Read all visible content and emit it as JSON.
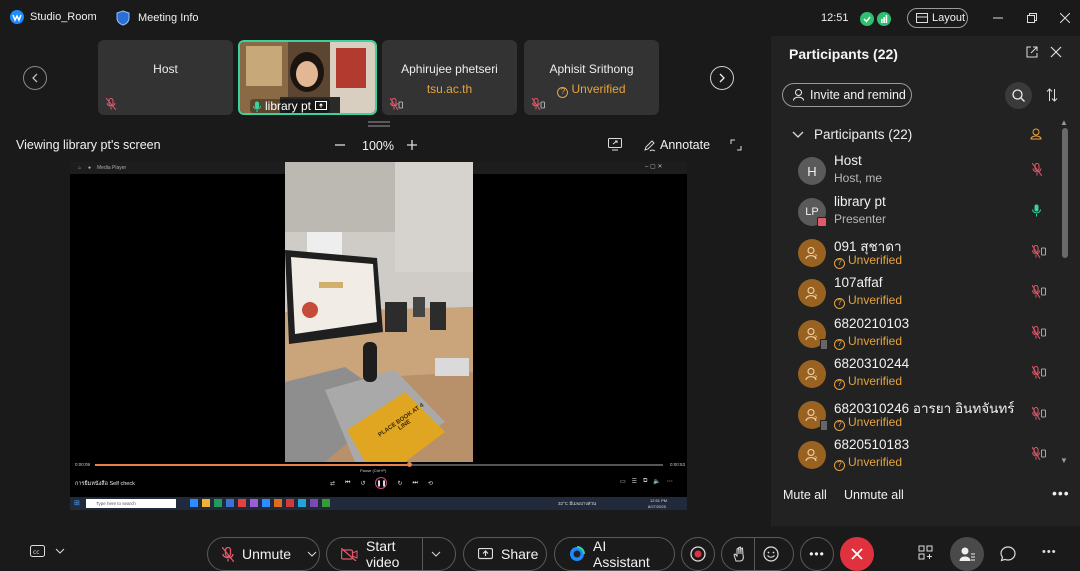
{
  "titlebar": {
    "app_name": "Studio_Room",
    "meeting_info_label": "Meeting Info",
    "time": "12:51",
    "layout_label": "Layout"
  },
  "stage": {
    "tiles": [
      {
        "name": "Host",
        "sub": ""
      },
      {
        "name": "library pt",
        "sub": ""
      },
      {
        "name": "Aphirujee phetseri",
        "sub": "tsu.ac.th"
      },
      {
        "name": "Aphisit Srithong",
        "sub": "Unverified"
      }
    ],
    "viewing_label": "Viewing library pt's screen",
    "zoom": "100%",
    "annotate_label": "Annotate"
  },
  "shared_screen": {
    "player_title": "Media Player",
    "video_caption": "การยืมหนังสือ Self check",
    "time_start": "0:00:09",
    "time_end": "0:00:53",
    "pause_label": "Pause (Ctrl+P)",
    "search_placeholder": "Type here to search",
    "tray_weather": "32°C  มีเมฆบางส่วน",
    "tray_time": "12:51 PM",
    "tray_date": "8/27/2025",
    "kiosk_sign": "PLACE BOOK AT 4 LINE"
  },
  "panel": {
    "title": "Participants (22)",
    "invite_label": "Invite and remind",
    "section_label": "Participants (22)",
    "participants": [
      {
        "name": "Host",
        "status": "Host, me",
        "avatar": "H",
        "kind": "initial",
        "warn": false
      },
      {
        "name": "library pt",
        "status": "Presenter",
        "avatar": "LP",
        "kind": "initial",
        "warn": false
      },
      {
        "name": "091 สุชาดา",
        "status": "Unverified",
        "avatar": "",
        "kind": "guest",
        "warn": true
      },
      {
        "name": "107affaf",
        "status": "Unverified",
        "avatar": "",
        "kind": "guest",
        "warn": true
      },
      {
        "name": "6820210103",
        "status": "Unverified",
        "avatar": "",
        "kind": "guest-phone",
        "warn": true
      },
      {
        "name": "6820310244",
        "status": "Unverified",
        "avatar": "",
        "kind": "guest",
        "warn": true
      },
      {
        "name": "6820310246 อารยา อินทจันทร์",
        "status": "Unverified",
        "avatar": "",
        "kind": "guest-phone",
        "warn": true
      },
      {
        "name": "6820510183",
        "status": "Unverified",
        "avatar": "",
        "kind": "guest",
        "warn": true
      }
    ],
    "mute_all_label": "Mute all",
    "unmute_all_label": "Unmute all"
  },
  "toolbar": {
    "unmute_label": "Unmute",
    "start_video_label": "Start video",
    "share_label": "Share",
    "ai_label": "AI Assistant"
  },
  "colors": {
    "accent_green": "#3ad29f",
    "warning": "#e8a33c",
    "muted_red": "#e05a6a",
    "end_call": "#e0313e",
    "brand_blue": "#1a8cff"
  }
}
